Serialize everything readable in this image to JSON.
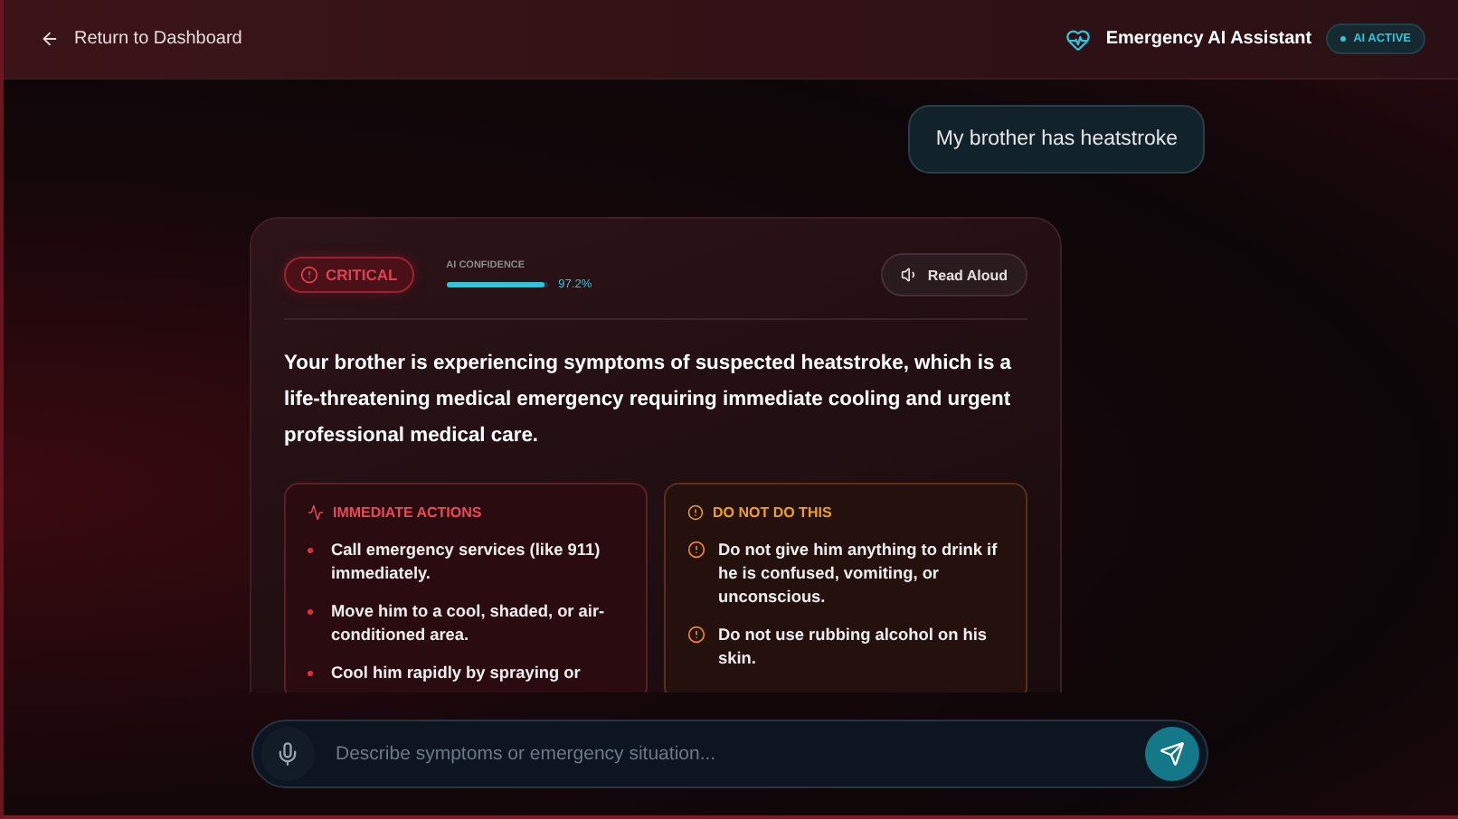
{
  "header": {
    "back_link": "Return to Dashboard",
    "title": "Emergency AI Assistant",
    "status_badge": "AI ACTIVE"
  },
  "user_message": "My brother has heatstroke",
  "response": {
    "severity": {
      "label": "CRITICAL",
      "kind": "critical"
    },
    "confidence": {
      "label": "AI CONFIDENCE",
      "level": 0.972,
      "reading": "97.2%"
    },
    "read_aloud": "Read Aloud",
    "summary": "Your brother is experiencing symptoms of suspected heatstroke, which is a life-threatening medical emergency requiring immediate cooling and urgent professional medical care.",
    "sections": [
      {
        "kind": "actions",
        "title": "IMMEDIATE ACTIONS",
        "items": [
          "Call emergency services (like 911) immediately.",
          "Move him to a cool, shaded, or air-conditioned area.",
          "Cool him rapidly by spraying or"
        ]
      },
      {
        "kind": "warnings",
        "title": "DO NOT DO THIS",
        "items": [
          "Do not give him anything to drink if he is confused, vomiting, or unconscious.",
          "Do not use rubbing alcohol on his skin."
        ]
      }
    ]
  },
  "input": {
    "placeholder": "Describe symptoms or emergency situation..."
  }
}
